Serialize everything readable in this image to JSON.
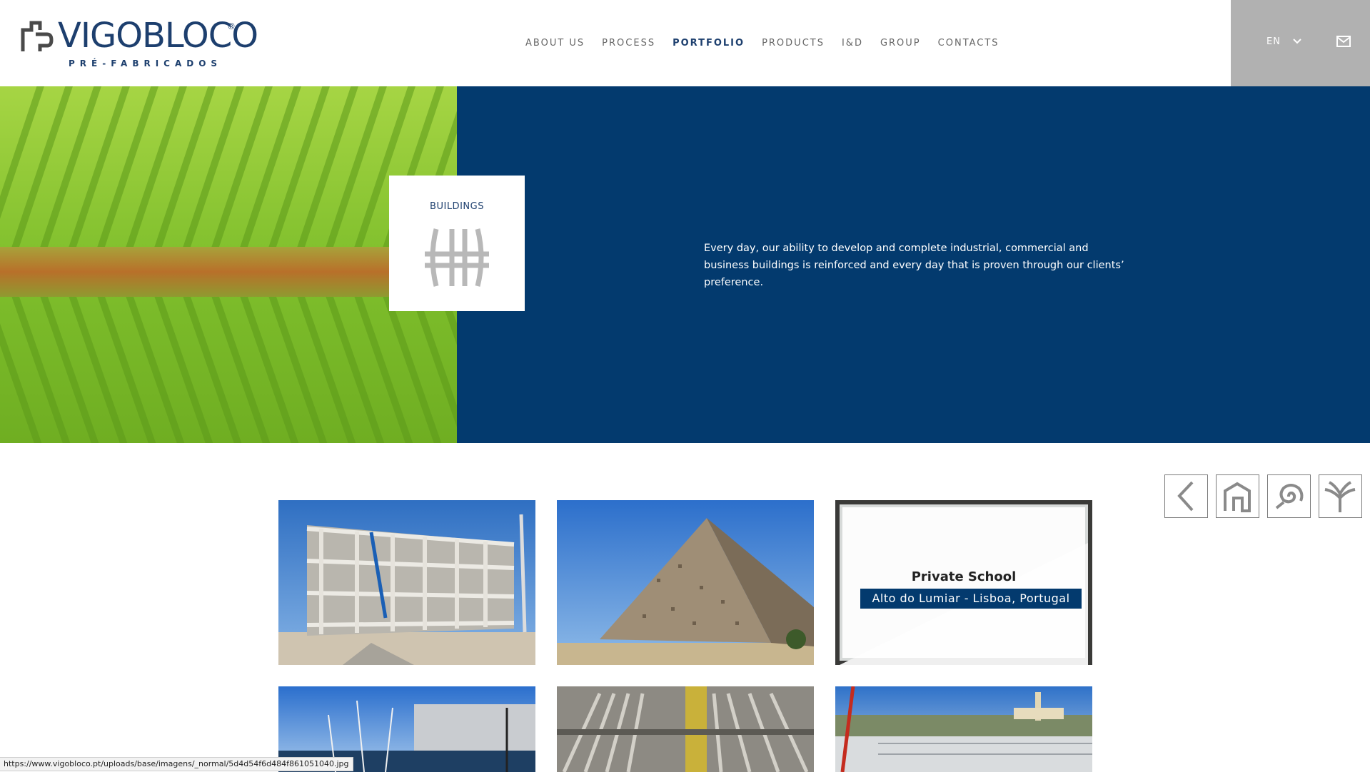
{
  "logo": {
    "name": "VIGOBLOCO",
    "registered": "®",
    "tagline": "PRÉ-FABRICADOS"
  },
  "nav": {
    "items": [
      {
        "label": "ABOUT US"
      },
      {
        "label": "PROCESS"
      },
      {
        "label": "PORTFOLIO",
        "active": true
      },
      {
        "label": "PRODUCTS"
      },
      {
        "label": "I&D"
      },
      {
        "label": "GROUP"
      },
      {
        "label": "CONTACTS"
      }
    ]
  },
  "utility": {
    "language": "EN",
    "language_icon": "chevron-down-icon",
    "mail_icon": "envelope-icon"
  },
  "hero": {
    "category_label": "BUILDINGS",
    "category_icon": "buildings-icon",
    "description": "Every day, our ability to develop and complete industrial, commercial and business buildings is reinforced and every day that is proven through our clients’ preference.",
    "category_nav": [
      {
        "icon": "chevron-left-icon"
      },
      {
        "icon": "house-icon"
      },
      {
        "icon": "spiral-icon"
      },
      {
        "icon": "tree-icon"
      }
    ]
  },
  "projects": [
    {
      "image": "precast-building-frame-under-construction"
    },
    {
      "image": "perforated-facade-building"
    },
    {
      "image": "school-structure",
      "title": "Private School",
      "location": "Alto do Lumiar - Lisboa, Portugal"
    },
    {
      "image": "modern-building-with-trees"
    },
    {
      "image": "construction-site-aerial"
    },
    {
      "image": "rooftop-view-city"
    }
  ],
  "status_bar": {
    "url": "https://www.vigobloco.pt/uploads/base/imagens/_normal/5d4d54f6d484f861051040.jpg"
  },
  "colors": {
    "brand_blue": "#033a6e",
    "logo_blue": "#1d3f6e",
    "utility_gray": "#b1b1b1",
    "leaf_green": "#8cc43a"
  }
}
